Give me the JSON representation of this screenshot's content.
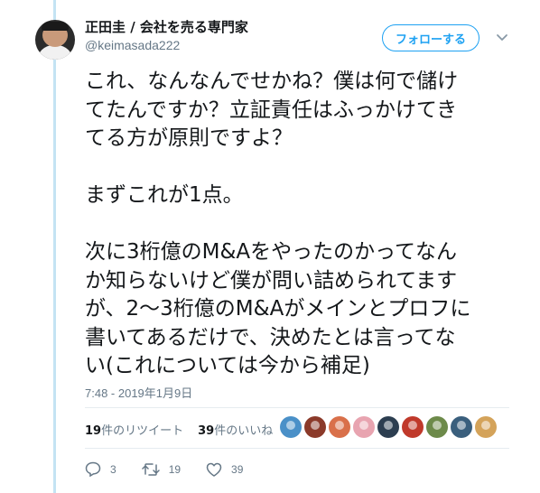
{
  "author": {
    "name": "正田圭 / 会社を売る専門家",
    "handle": "@keimasada222"
  },
  "follow_label": "フォローする",
  "tweet": {
    "text": "これ、なんなんでせかね？僕は何で儲け\nてたんですか？立証責任はふっかけてき\nてる方が原則ですよ？\n\nまずこれが1点。\n\n次に3桁億のM&Aをやったのかってなん\nか知らないけど僕が問い詰められてます\nが、2〜3桁億のM&Aがメインとプロフに\n書いてあるだけで、決めたとは言ってな\nい(これについては今から補足)",
    "timestamp": "7:48 - 2019年1月9日"
  },
  "stats": {
    "retweets_count": "19",
    "retweets_label": "件のリツイート",
    "likes_count": "39",
    "likes_label": "件のいいね"
  },
  "likers": [
    {
      "icon": "liker-avatar",
      "color": "#4a90c8"
    },
    {
      "icon": "liker-avatar",
      "color": "#8b3a2a"
    },
    {
      "icon": "liker-avatar",
      "color": "#d9704a"
    },
    {
      "icon": "liker-avatar",
      "color": "#e8a4b0"
    },
    {
      "icon": "liker-avatar",
      "color": "#2c3e50"
    },
    {
      "icon": "liker-avatar",
      "color": "#c0392b"
    },
    {
      "icon": "liker-avatar",
      "color": "#6d8a4a"
    },
    {
      "icon": "liker-avatar",
      "color": "#3a5f7d"
    },
    {
      "icon": "liker-avatar",
      "color": "#d4a35a"
    }
  ],
  "actions": {
    "reply_count": "3",
    "retweet_count": "19",
    "like_count": "39"
  },
  "colors": {
    "accent": "#1da1f2",
    "thread_line": "#c4e3f3",
    "muted": "#657786"
  }
}
